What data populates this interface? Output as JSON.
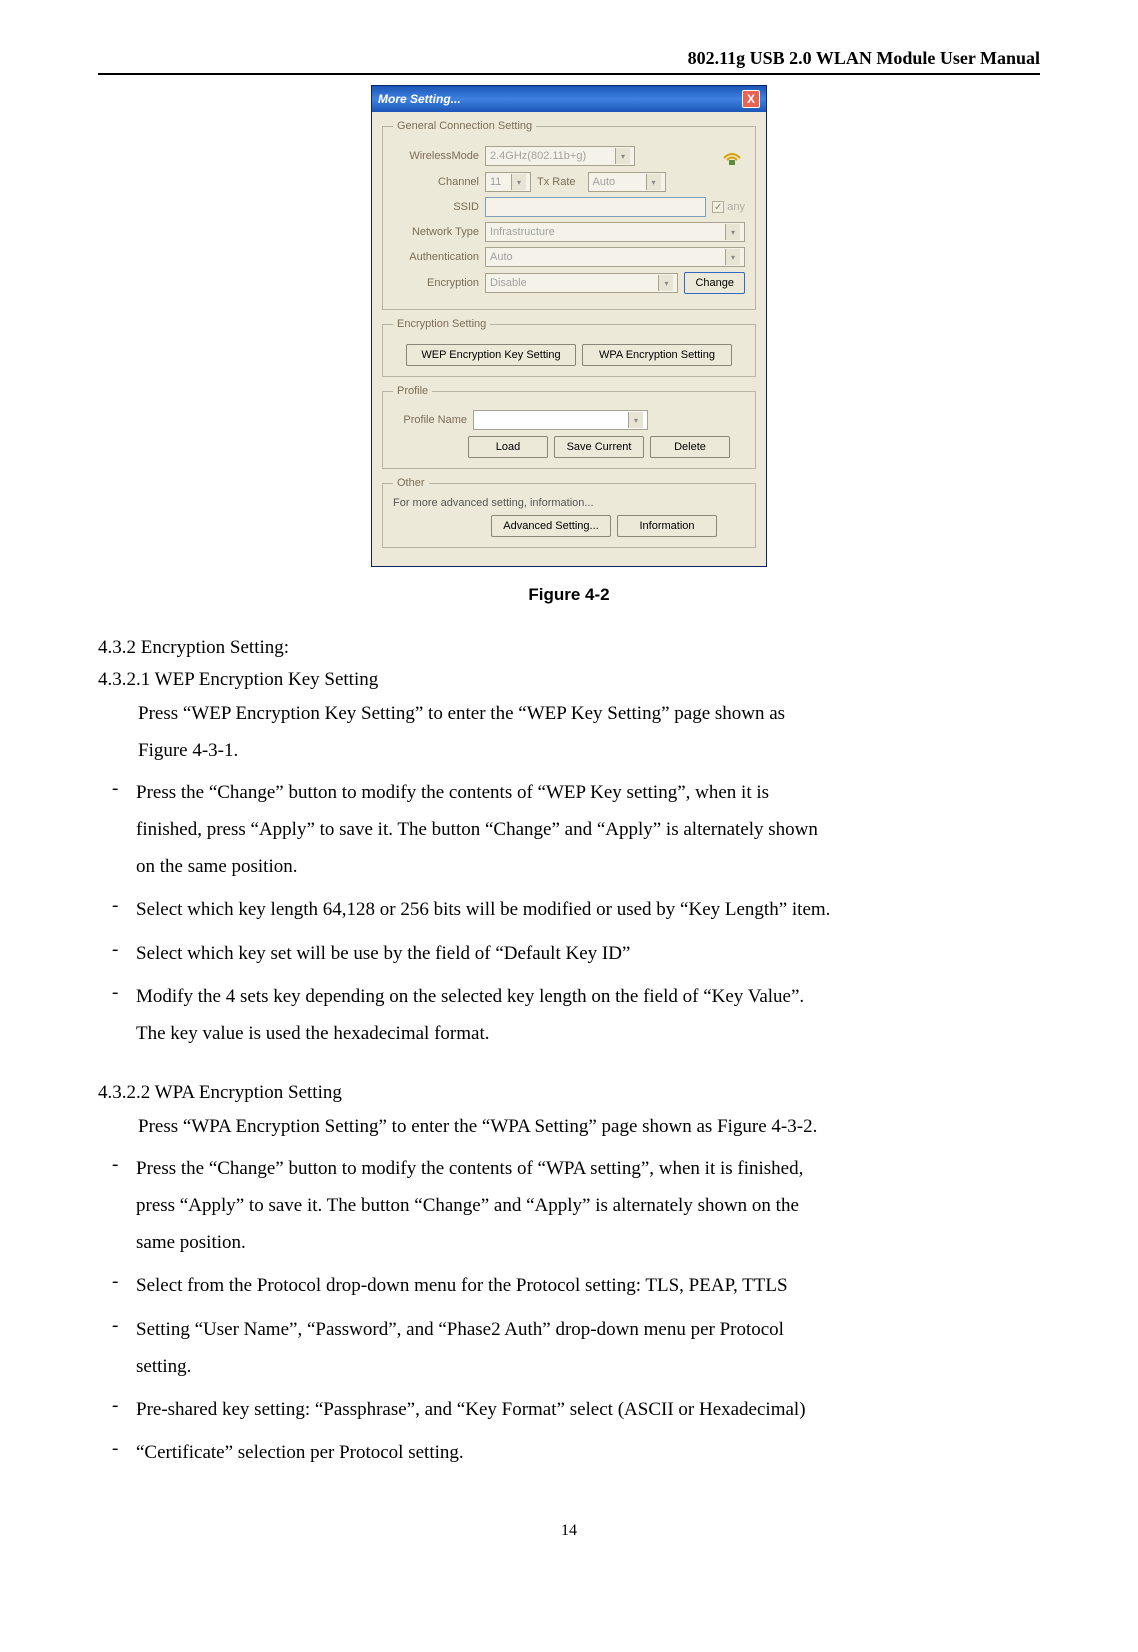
{
  "header_title": "802.11g USB 2.0 WLAN Module User Manual",
  "dialog": {
    "title": "More Setting...",
    "close_x": "X",
    "general": {
      "legend": "General Connection Setting",
      "wireless_mode_label": "WirelessMode",
      "wireless_mode_value": "2.4GHz(802.11b+g)",
      "channel_label": "Channel",
      "channel_value": "11",
      "txrate_label": "Tx Rate",
      "txrate_value": "Auto",
      "ssid_label": "SSID",
      "ssid_value": "",
      "any_label": "any",
      "network_type_label": "Network Type",
      "network_type_value": "Infrastructure",
      "auth_label": "Authentication",
      "auth_value": "Auto",
      "encryption_label": "Encryption",
      "encryption_value": "Disable",
      "change_btn": "Change"
    },
    "enc": {
      "legend": "Encryption Setting",
      "wep_btn": "WEP Encryption Key Setting",
      "wpa_btn": "WPA Encryption Setting"
    },
    "profile": {
      "legend": "Profile",
      "name_label": "Profile Name",
      "name_value": "",
      "load_btn": "Load",
      "save_btn": "Save Current",
      "delete_btn": "Delete"
    },
    "other": {
      "legend": "Other",
      "note": "For more advanced setting, information...",
      "adv_btn": "Advanced Setting...",
      "info_btn": "Information"
    }
  },
  "figure_caption": "Figure 4-2",
  "sec_432": "4.3.2 Encryption Setting:",
  "sec_4321": "4.3.2.1 WEP Encryption Key Setting",
  "wep_intro_a": "Press “WEP Encryption Key Setting” to enter the “WEP Key Setting” page shown as",
  "wep_intro_b": "Figure 4-3-1.",
  "wep_b1_a": "Press the “Change” button to modify the contents of “WEP Key setting”, when it is",
  "wep_b1_b": "finished, press “Apply” to save it. The button “Change” and “Apply” is alternately shown",
  "wep_b1_c": "on the same position.",
  "wep_b2": "Select which key length 64,128 or 256 bits will be modified or used by “Key Length” item.",
  "wep_b3": "Select which key set will be use by the field of “Default Key ID”",
  "wep_b4_a": "Modify the 4 sets key depending on the selected key length on the field of “Key Value”.",
  "wep_b4_b": "The key value is used the hexadecimal format.",
  "sec_4322": "4.3.2.2 WPA Encryption Setting",
  "wpa_intro": "Press “WPA Encryption Setting” to enter the “WPA Setting” page shown as Figure 4-3-2.",
  "wpa_b1_a": "Press the “Change” button to modify the contents of “WPA setting”, when it is finished,",
  "wpa_b1_b": "press “Apply” to save it. The button “Change” and “Apply” is alternately shown on the",
  "wpa_b1_c": "same position.",
  "wpa_b2": "Select from the Protocol drop-down menu for the Protocol setting: TLS, PEAP, TTLS",
  "wpa_b3_a": "Setting “User Name”, “Password”, and “Phase2 Auth” drop-down menu per Protocol",
  "wpa_b3_b": "setting.",
  "wpa_b4": "Pre-shared key setting: “Passphrase”, and “Key Format” select (ASCII or Hexadecimal)",
  "wpa_b5": "“Certificate” selection per Protocol setting.",
  "page_number": "14"
}
